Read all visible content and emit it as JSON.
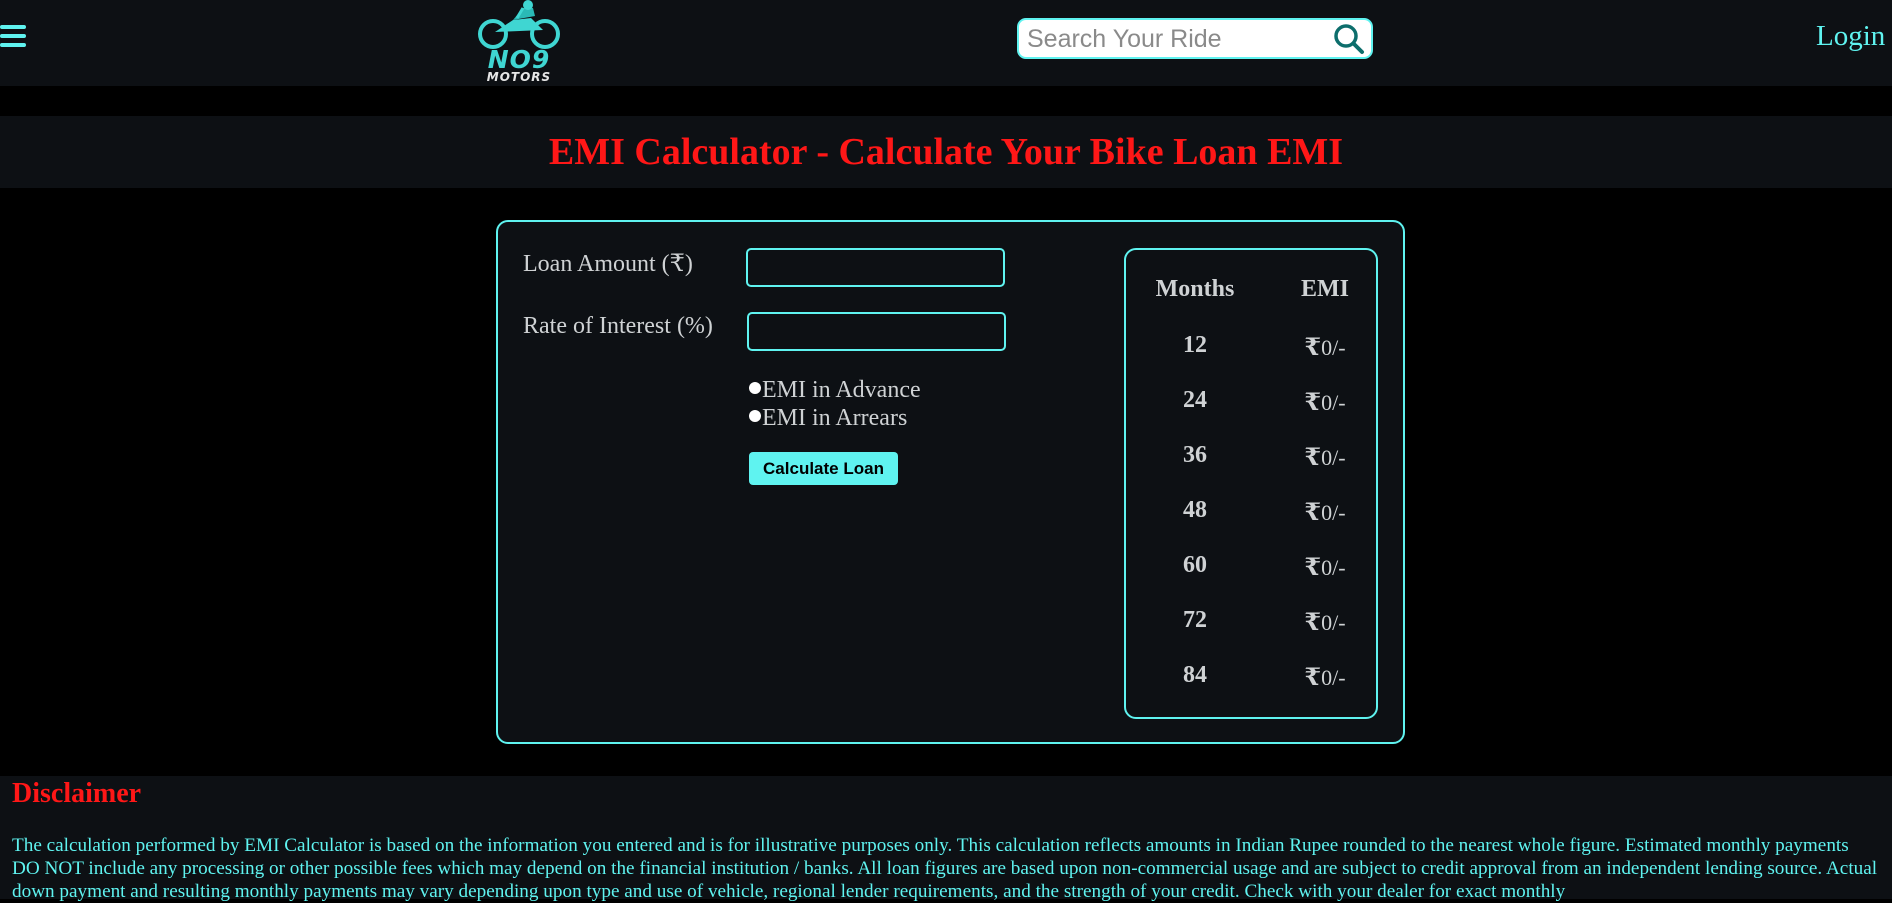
{
  "header": {
    "logo_text": "NO9",
    "logo_sub": "MOTORS",
    "search_placeholder": "Search Your Ride",
    "login_label": "Login"
  },
  "colors": {
    "accent": "#5ff3f0",
    "title_red": "#ff1717",
    "panel_bg": "#0d1014",
    "page_bg": "#000000"
  },
  "page_title": "EMI Calculator - Calculate Your Bike Loan EMI",
  "form": {
    "loan_amount_label": "Loan Amount (₹)",
    "loan_amount_value": "",
    "rate_label": "Rate of Interest (%)",
    "rate_value": "",
    "radio_advance": "EMI in Advance",
    "radio_arrears": "EMI in Arrears",
    "calculate_label": "Calculate Loan"
  },
  "emi_table": {
    "headers": [
      "Months",
      "EMI"
    ],
    "rows": [
      {
        "months": "12",
        "rupee": "₹",
        "emi": "0/-"
      },
      {
        "months": "24",
        "rupee": "₹",
        "emi": "0/-"
      },
      {
        "months": "36",
        "rupee": "₹",
        "emi": "0/-"
      },
      {
        "months": "48",
        "rupee": "₹",
        "emi": "0/-"
      },
      {
        "months": "60",
        "rupee": "₹",
        "emi": "0/-"
      },
      {
        "months": "72",
        "rupee": "₹",
        "emi": "0/-"
      },
      {
        "months": "84",
        "rupee": "₹",
        "emi": "0/-"
      }
    ]
  },
  "disclaimer": {
    "title": "Disclaimer",
    "text": "The calculation performed by EMI Calculator is based on the information you entered and is for illustrative purposes only. This calculation reflects amounts in Indian Rupee rounded to the nearest whole figure. Estimated monthly payments DO NOT include any processing or other possible fees which may depend on the financial institution / banks. All loan figures are based upon non-commercial usage and are subject to credit approval from an independent lending source. Actual down payment and resulting monthly payments may vary depending upon type and use of vehicle, regional lender requirements, and the strength of your credit. Check with your dealer for exact monthly"
  }
}
